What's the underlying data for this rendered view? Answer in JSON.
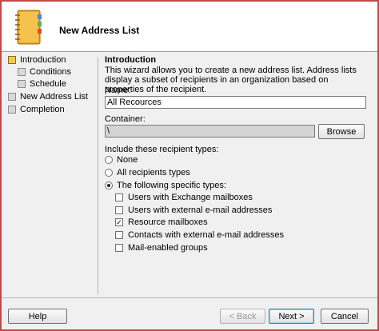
{
  "window": {
    "title": "New Address List",
    "accent_border": "#c24a4a"
  },
  "sidebar": {
    "steps": [
      {
        "label": "Introduction",
        "active": true
      },
      {
        "label": "Conditions",
        "active": false
      },
      {
        "label": "Schedule",
        "active": false
      },
      {
        "label": "New Address List",
        "active": false
      },
      {
        "label": "Completion",
        "active": false
      }
    ]
  },
  "content": {
    "section_title": "Introduction",
    "description": "This wizard allows you to create a new address list. Address lists display a subset of recipients in an organization based on properties of the recipient.",
    "name_label": "Name:",
    "name_value": "All Recources",
    "container_label": "Container:",
    "container_value": "\\",
    "browse_label": "Browse",
    "include_label": "Include these recipient types:",
    "radios": [
      {
        "label": "None",
        "selected": false
      },
      {
        "label": "All recipients types",
        "selected": false
      },
      {
        "label": "The following specific types:",
        "selected": true
      }
    ],
    "checkboxes": [
      {
        "label": "Users with Exchange mailboxes",
        "checked": false
      },
      {
        "label": "Users with external e-mail addresses",
        "checked": false
      },
      {
        "label": "Resource mailboxes",
        "checked": true
      },
      {
        "label": "Contacts with external e-mail addresses",
        "checked": false
      },
      {
        "label": "Mail-enabled groups",
        "checked": false
      }
    ]
  },
  "footer": {
    "help_label": "Help",
    "back_label": "< Back",
    "next_label": "Next >",
    "cancel_label": "Cancel"
  },
  "icons": {
    "wizard": "address-book-icon",
    "checkmark": "✓"
  }
}
